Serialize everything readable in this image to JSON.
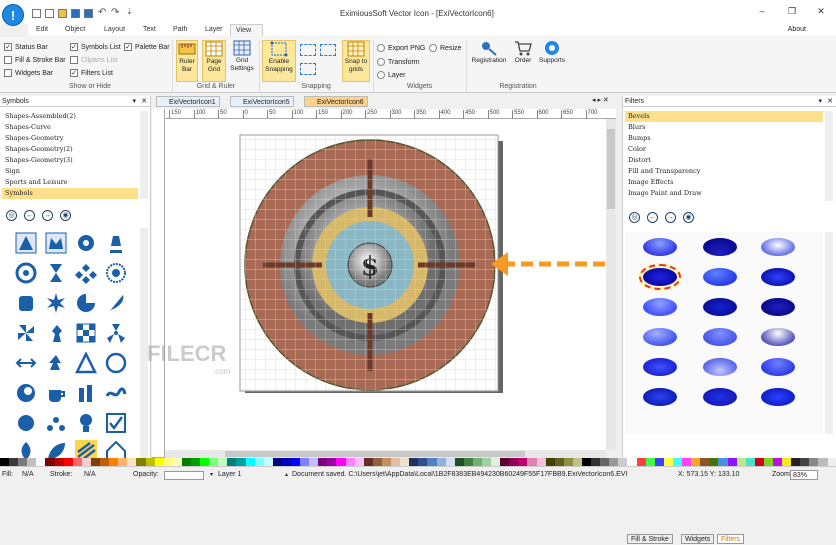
{
  "title": "EximiousSoft Vector Icon - [ExiVectorIcon6]",
  "menu": [
    "Edit",
    "Object",
    "Layout",
    "Text",
    "Path",
    "Layer",
    "View"
  ],
  "about": "About",
  "ribbon": {
    "show_or_hide": {
      "label": "Show or Hide",
      "items": [
        {
          "label": "Status Bar",
          "checked": true
        },
        {
          "label": "Symbols List",
          "checked": true
        },
        {
          "label": "Palette Bar",
          "checked": true
        },
        {
          "label": "Fill & Stroke Bar",
          "checked": false
        },
        {
          "label": "Cliparts List",
          "checked": false
        },
        {
          "label": "Widgets Bar",
          "checked": false
        },
        {
          "label": "Filters List",
          "checked": true
        }
      ]
    },
    "grid_ruler": {
      "label": "Grid & Ruler",
      "ruler": "Ruler Bar",
      "page": "Page Grid",
      "grid": "Grid Settings"
    },
    "snapping": {
      "label": "Snapping",
      "enable": "Enable Snapping",
      "snap": "Snap to grids"
    },
    "widgets": {
      "label": "Widgets",
      "export": "Export PNG",
      "resize": "Resize",
      "transform": "Transform",
      "layer": "Layer"
    },
    "registration": {
      "label": "Registration",
      "reg": "Registration",
      "order": "Order",
      "supports": "Supports"
    }
  },
  "symbols": {
    "header": "Symbols",
    "items": [
      "Shapes-Assembled(2)",
      "Shapes-Curve",
      "Shapes-Geometry",
      "Shapes-Geometry(2)",
      "Shapes-Geometry(3)",
      "Sign",
      "Sports and Leisure",
      "Symbols"
    ],
    "selected_index": 7
  },
  "filters": {
    "header": "Filters",
    "items": [
      "Bevels",
      "Blurs",
      "Bumps",
      "Color",
      "Distort",
      "Fill and Transparency",
      "Image Effects",
      "Image Paint and Draw"
    ],
    "selected_index": 0,
    "tabs": [
      "Fill & Stroke",
      "Widgets",
      "Filters"
    ],
    "active_tab": 2
  },
  "doc_tabs": [
    "ExiVectorIcon1",
    "ExiVectorIcon5",
    "ExiVectorIcon6"
  ],
  "active_doc": 2,
  "ruler_ticks": [
    "150",
    "100",
    "50",
    "0",
    "50",
    "100",
    "150",
    "200",
    "250",
    "300",
    "350",
    "400",
    "450",
    "500",
    "550",
    "600",
    "650",
    "700"
  ],
  "status": {
    "fill_label": "Fill:",
    "fill": "N/A",
    "stroke_label": "Stroke:",
    "stroke": "N/A",
    "opacity_label": "Opacity:",
    "layer": "Layer 1",
    "message": "Document saved. C:\\Users\\jet\\AppData\\Local\\1B2F8383EB494230B60249F55F17FBB9.ExiVectorIcon6.EVI",
    "coords": "X: 573.15 Y: 133.10",
    "zoom_label": "Zoom:",
    "zoom": "83%"
  },
  "watermark": {
    "text": "FILECR",
    "sub": ".com"
  },
  "colors": {
    "accent": "#1e88e5",
    "highlight": "#ffe08a",
    "orange": "#f5a623"
  },
  "palette": [
    "#000000",
    "#3a3a3a",
    "#7a7a7a",
    "#c0c0c0",
    "#ffffff",
    "#800000",
    "#c00000",
    "#ff0000",
    "#ff6666",
    "#ffcccc",
    "#804000",
    "#c06000",
    "#ff8000",
    "#ffb366",
    "#ffe0c0",
    "#808000",
    "#c0c000",
    "#ffff00",
    "#ffff80",
    "#ffffc0",
    "#008000",
    "#00a000",
    "#00ff00",
    "#80ff80",
    "#c0ffc0",
    "#008080",
    "#00a0a0",
    "#00ffff",
    "#80ffff",
    "#c0ffff",
    "#000080",
    "#0000c0",
    "#0000ff",
    "#8080ff",
    "#c0c0ff",
    "#800080",
    "#a000a0",
    "#ff00ff",
    "#ff80ff",
    "#ffc0ff",
    "#603020",
    "#906040",
    "#c09060",
    "#e0c0a0",
    "#f0e0d0",
    "#203060",
    "#305090",
    "#5080c0",
    "#90b0e0",
    "#d0e0f0",
    "#205020",
    "#408040",
    "#70b070",
    "#a0d0a0",
    "#e0f0e0",
    "#600030",
    "#900050",
    "#c00070",
    "#e080b0",
    "#f0c0d8",
    "#404000",
    "#606020",
    "#909040",
    "#c0c080",
    "#000000",
    "#333333",
    "#666666",
    "#999999",
    "#cccccc",
    "#ffffff",
    "#ff4040",
    "#40ff40",
    "#4040ff",
    "#ffff40",
    "#40ffff",
    "#ff40ff",
    "#f5a623",
    "#8b572a",
    "#417505",
    "#4a90e2",
    "#9013fe",
    "#b8e986",
    "#50e3c2",
    "#d0021b",
    "#7ed321",
    "#bd10e0",
    "#f8e71c",
    "#222",
    "#444",
    "#888",
    "#bbb",
    "#eee"
  ]
}
